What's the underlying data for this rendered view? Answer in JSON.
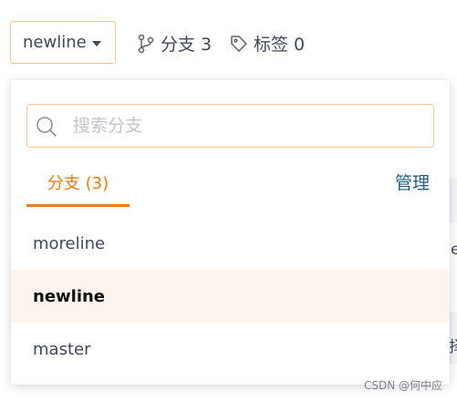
{
  "header": {
    "branch_selector": "newline",
    "branches_stat": "分支 3",
    "tags_stat": "标签 0"
  },
  "dropdown": {
    "search_placeholder": "搜索分支",
    "search_value": "",
    "tab_label": "分支 (3)",
    "manage_label": "管理",
    "branches": [
      {
        "name": "moreline",
        "active": false
      },
      {
        "name": "newline",
        "active": true
      },
      {
        "name": "master",
        "active": false
      }
    ]
  },
  "background": {
    "frag_1": "e",
    "frag_2": "择"
  },
  "watermark": "CSDN @何中应",
  "colors": {
    "accent_orange": "#f77a10",
    "focus_border": "#f0c98b",
    "link_blue": "#1e5f86",
    "active_row_bg": "#fdf4ef",
    "text": "#40485b"
  },
  "icons": {
    "branch_selector_caret": "caret-down-icon",
    "branches_stat": "git-branch-icon",
    "tags_stat": "tag-icon",
    "search": "search-icon"
  }
}
